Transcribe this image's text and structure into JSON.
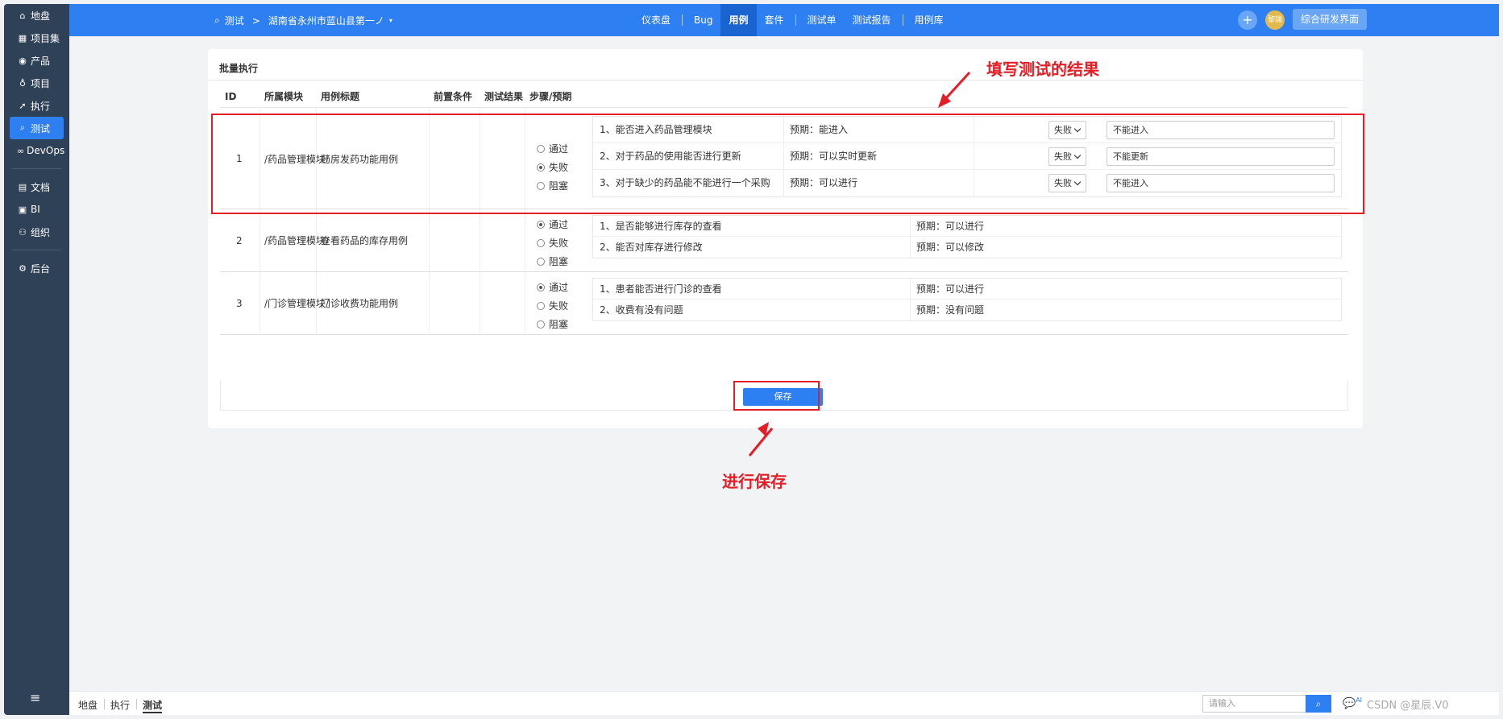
{
  "sidebar": {
    "items": [
      {
        "label": "地盘",
        "icon": "home-icon"
      },
      {
        "label": "项目集",
        "icon": "grid-icon"
      },
      {
        "label": "产品",
        "icon": "lightbulb-icon"
      },
      {
        "label": "项目",
        "icon": "bell-icon"
      },
      {
        "label": "执行",
        "icon": "run-icon"
      },
      {
        "label": "测试",
        "icon": "test-icon",
        "active": true
      },
      {
        "label": "DevOps",
        "icon": "infinity-icon"
      },
      {
        "label": "文档",
        "icon": "document-icon"
      },
      {
        "label": "BI",
        "icon": "chart-icon"
      },
      {
        "label": "组织",
        "icon": "people-icon"
      },
      {
        "label": "后台",
        "icon": "gear-icon"
      }
    ],
    "collapse_icon": "≡"
  },
  "header": {
    "breadcrumb_root": "测试",
    "breadcrumb_sep": ">",
    "breadcrumb_product": "湖南省永州市蓝山县第一ノ",
    "nav": [
      "仪表盘",
      "Bug",
      "用例",
      "套件",
      "测试单",
      "测试报告",
      "用例库"
    ],
    "active_nav": "用例",
    "plus": "+",
    "avatar_text": "黎瑞",
    "env_button": "综合研发界面",
    "accent": "#2e7ff2"
  },
  "panel": {
    "title": "批量执行",
    "columns": [
      "ID",
      "所属模块",
      "用例标题",
      "前置条件",
      "测试结果",
      "步骤/预期"
    ],
    "result_options": [
      "通过",
      "失败",
      "阻塞"
    ],
    "rows": [
      {
        "id": "1",
        "module": "/药品管理模块/",
        "title": "药房发药功能用例",
        "precondition": "",
        "result": "失败",
        "steps": [
          {
            "desc": "1、能否进入药品管理模块",
            "expect": "预期：能进入",
            "status": "失败",
            "actual": "不能进入"
          },
          {
            "desc": "2、对于药品的使用能否进行更新",
            "expect": "预期：可以实时更新",
            "status": "失败",
            "actual": "不能更新"
          },
          {
            "desc": "3、对于缺少的药品能不能进行一个采购",
            "expect": "预期：可以进行",
            "status": "失败",
            "actual": "不能进入"
          }
        ]
      },
      {
        "id": "2",
        "module": "/药品管理模块/",
        "title": "查看药品的库存用例",
        "precondition": "",
        "result": "通过",
        "steps": [
          {
            "desc": "1、是否能够进行库存的查看",
            "expect": "预期：可以进行"
          },
          {
            "desc": "2、能否对库存进行修改",
            "expect": "预期：可以修改"
          }
        ]
      },
      {
        "id": "3",
        "module": "/门诊管理模块/",
        "title": "门诊收费功能用例",
        "precondition": "",
        "result": "通过",
        "steps": [
          {
            "desc": "1、患者能否进行门诊的查看",
            "expect": "预期：可以进行"
          },
          {
            "desc": "2、收费有没有问题",
            "expect": "预期：没有问题"
          }
        ]
      }
    ],
    "save_label": "保存"
  },
  "annotations": {
    "fill_results": "填写测试的结果",
    "save_hint": "进行保存",
    "color": "#e41e26"
  },
  "footer": {
    "tabs": [
      "地盘",
      "执行",
      "测试"
    ],
    "active_tab": "测试",
    "search_placeholder": "请输入",
    "ai_label": "AI",
    "watermark": "CSDN @星辰.V0"
  }
}
